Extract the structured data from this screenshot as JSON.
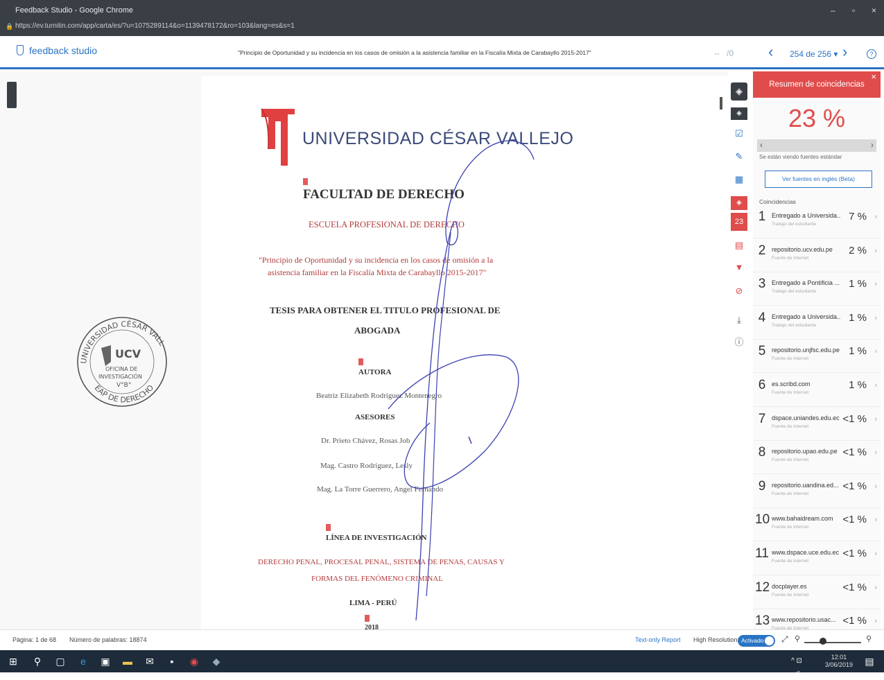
{
  "browser": {
    "window_title": "Feedback Studio - Google Chrome",
    "url": "https://ev.turnitin.com/app/carta/es/?u=1075289114&o=1139478172&ro=103&lang=es&s=1",
    "minimize": "–",
    "restore": "▫",
    "close": "×"
  },
  "header": {
    "logo_text": "feedback studio",
    "doc_title": "\"Principio de Oportunidad y su incidencia en los casos de omisión a la asistencia familiar en la Fiscalía Mixta de Carabayllo 2015-2017\"",
    "page_dash": "--",
    "page_total": "/0",
    "prev": "‹",
    "next": "›",
    "nav_text": "254 de 256 ▾",
    "help": "?"
  },
  "document": {
    "university": "UNIVERSIDAD CÉSAR VALLEJO",
    "faculty": "FACULTAD DE DERECHO",
    "school": "ESCUELA PROFESIONAL DE DERECHO",
    "title_line1": "\"Principio de Oportunidad y su incidencia en los casos de omisión a la",
    "title_line2": "asistencia familiar en la Fiscalía Mixta de Carabayllo 2015-2017\"",
    "thesis_line1": "TESIS PARA OBTENER EL TITULO PROFESIONAL DE",
    "thesis_line2": "ABOGADA",
    "author_label": "AUTORA",
    "author": "Beatriz Elizabeth Rodríguez Montenegro",
    "advisors_label": "ASESORES",
    "advisor1": "Dr. Prieto Chávez, Rosas Job",
    "advisor2": "Mag. Castro Rodríguez, Lesly",
    "advisor3": "Mag. La Torre Guerrero, Angel Fernando",
    "research_label": "LÍNEA DE INVESTIGACIÓN",
    "research_line1": "DERECHO PENAL, PROCESAL PENAL, SISTEMA DE PENAS, CAUSAS Y",
    "research_line2": "FORMAS DEL FENÓMENO CRIMINAL",
    "place": "LIMA - PERÚ",
    "year": "2018"
  },
  "stamp": {
    "outer_top": "UNIVERSIDAD CÉSAR VALLEJO",
    "outer_bottom": "EAP DE DERECHO",
    "brand": "UCV",
    "office_line1": "OFICINA DE",
    "office_line2": "INVESTIGACIÓN",
    "approval": "V°B°"
  },
  "toolbar": {
    "layers_badge": "23"
  },
  "panel": {
    "title": "Resumen de coincidencias",
    "close": "×",
    "similarity": "23 %",
    "nav_prev": "‹",
    "nav_next": "›",
    "sources_note": "Se están viendo fuentes estándar",
    "english_button": "Ver fuentes en inglés (Beta)",
    "matches_label": "Coincidencias",
    "matches": [
      {
        "num": "1",
        "name": "Entregado a Universida...",
        "type": "Trabajo del estudiante",
        "pct": "7 %"
      },
      {
        "num": "2",
        "name": "repositorio.ucv.edu.pe",
        "type": "Fuente de Internet",
        "pct": "2 %"
      },
      {
        "num": "3",
        "name": "Entregado a Pontificia ...",
        "type": "Trabajo del estudiante",
        "pct": "1 %"
      },
      {
        "num": "4",
        "name": "Entregado a Universida...",
        "type": "Trabajo del estudiante",
        "pct": "1 %"
      },
      {
        "num": "5",
        "name": "repositorio.unjfsc.edu.pe",
        "type": "Fuente de Internet",
        "pct": "1 %"
      },
      {
        "num": "6",
        "name": "es.scribd.com",
        "type": "Fuente de Internet",
        "pct": "1 %"
      },
      {
        "num": "7",
        "name": "dspace.uniandes.edu.ec",
        "type": "Fuente de Internet",
        "pct": "<1 %"
      },
      {
        "num": "8",
        "name": "repositorio.upao.edu.pe",
        "type": "Fuente de Internet",
        "pct": "<1 %"
      },
      {
        "num": "9",
        "name": "repositorio.uandina.ed...",
        "type": "Fuente de Internet",
        "pct": "<1 %"
      },
      {
        "num": "10",
        "name": "www.bahaidream.com",
        "type": "Fuente de Internet",
        "pct": "<1 %"
      },
      {
        "num": "11",
        "name": "www.dspace.uce.edu.ec",
        "type": "Fuente de Internet",
        "pct": "<1 %"
      },
      {
        "num": "12",
        "name": "docplayer.es",
        "type": "Fuente de Internet",
        "pct": "<1 %"
      },
      {
        "num": "13",
        "name": "www.repositorio.usac...",
        "type": "Fuente de Internet",
        "pct": "<1 %"
      }
    ]
  },
  "status": {
    "page": "Página: 1 de 68",
    "words": "Número de palabras: 18874",
    "text_only": "Text-only Report",
    "high_res": "High Resolution",
    "toggle": "Activado"
  },
  "taskbar": {
    "time": "12:01",
    "date": "3/06/2019"
  },
  "colors": {
    "accent": "#2a73c5",
    "match_red": "#e04c4c",
    "pen_blue": "#3a3fb0"
  }
}
